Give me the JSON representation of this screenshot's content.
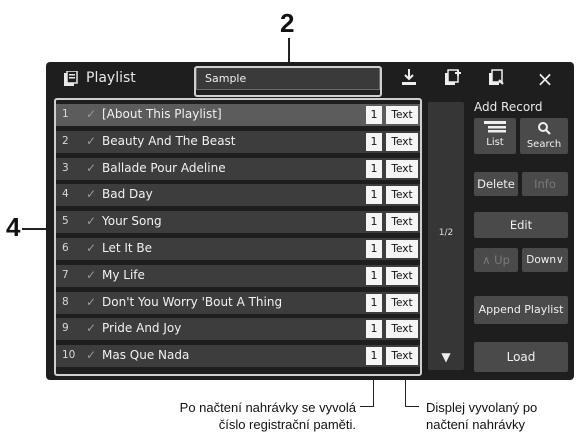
{
  "callouts": {
    "name_box": "2",
    "list": "4"
  },
  "topbar": {
    "title": "Playlist",
    "playlist_name": "Sample",
    "icons": [
      "playlist-icon",
      "save-icon",
      "add-file-icon",
      "load-file-icon",
      "close-icon"
    ],
    "close_label": "×"
  },
  "rows": [
    {
      "num": "1",
      "check": "✓",
      "song": "[About This Playlist]",
      "reg": "1",
      "text": "Text",
      "selected": true
    },
    {
      "num": "2",
      "check": "✓",
      "song": "Beauty And The Beast",
      "reg": "1",
      "text": "Text"
    },
    {
      "num": "3",
      "check": "✓",
      "song": "Ballade Pour Adeline",
      "reg": "1",
      "text": "Text"
    },
    {
      "num": "4",
      "check": "✓",
      "song": "Bad Day",
      "reg": "1",
      "text": "Text"
    },
    {
      "num": "5",
      "check": "✓",
      "song": "Your Song",
      "reg": "1",
      "text": "Text"
    },
    {
      "num": "6",
      "check": "✓",
      "song": "Let It Be",
      "reg": "1",
      "text": "Text"
    },
    {
      "num": "7",
      "check": "✓",
      "song": "My Life",
      "reg": "1",
      "text": "Text"
    },
    {
      "num": "8",
      "check": "✓",
      "song": "Don't You Worry 'Bout A Thing",
      "reg": "1",
      "text": "Text"
    },
    {
      "num": "9",
      "check": "✓",
      "song": "Pride And Joy",
      "reg": "1",
      "text": "Text"
    },
    {
      "num": "10",
      "check": "✓",
      "song": "Mas Que Nada",
      "reg": "1",
      "text": "Text"
    }
  ],
  "scroll": {
    "page": "1/2",
    "down_arrow": "▼"
  },
  "side": {
    "add_record": "Add Record",
    "list_label": "List",
    "search_label": "Search",
    "delete_label": "Delete",
    "info_label": "Info",
    "edit_label": "Edit",
    "up_label": "∧ Up",
    "down_label": "Down∨",
    "append_label": "Append Playlist",
    "load_label": "Load"
  },
  "captions": {
    "left_line1": "Po načtení nahrávky se vyvolá",
    "left_line2": "číslo registrační paměti.",
    "right_line1": "Displej vyvolaný po",
    "right_line2": "načtení nahrávky"
  }
}
